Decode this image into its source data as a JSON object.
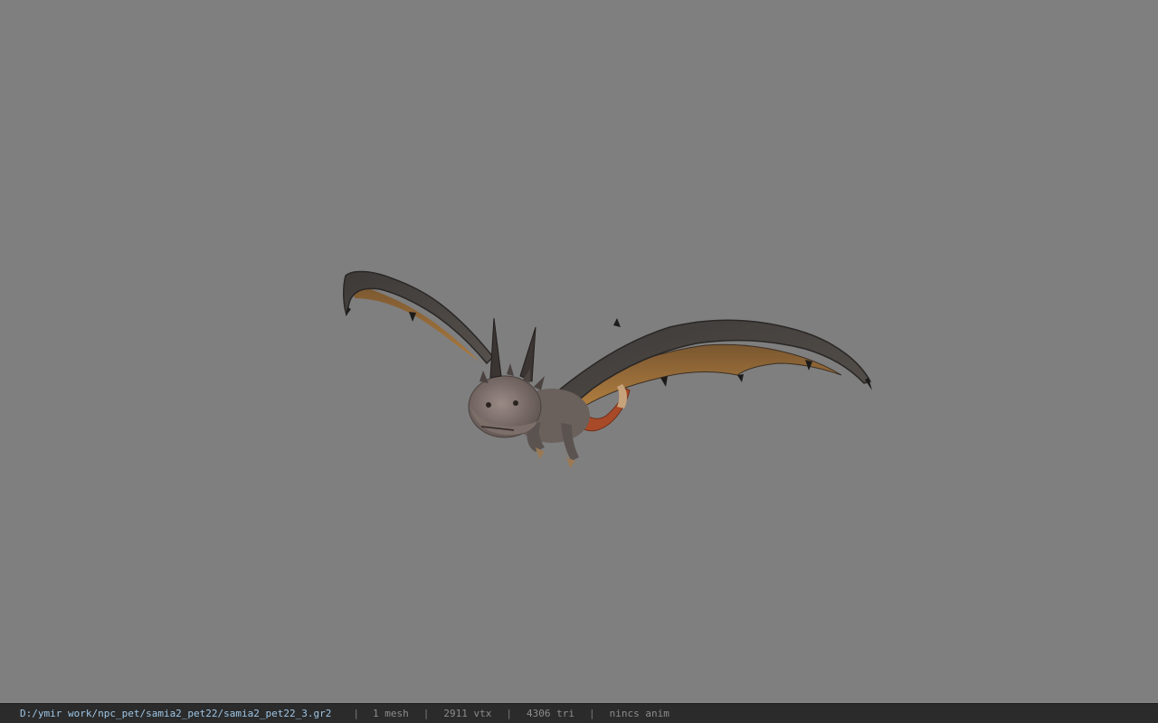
{
  "viewer": {
    "background_color": "#7f7f7f",
    "model_icon": "dragon-model"
  },
  "status": {
    "path": "D:/ymir work/npc_pet/samia2_pet22/samia2_pet22_3.gr2",
    "separator": "|",
    "mesh": "1 mesh",
    "vtx": "2911 vtx",
    "tri": "4306 tri",
    "anim": "nincs anim"
  }
}
